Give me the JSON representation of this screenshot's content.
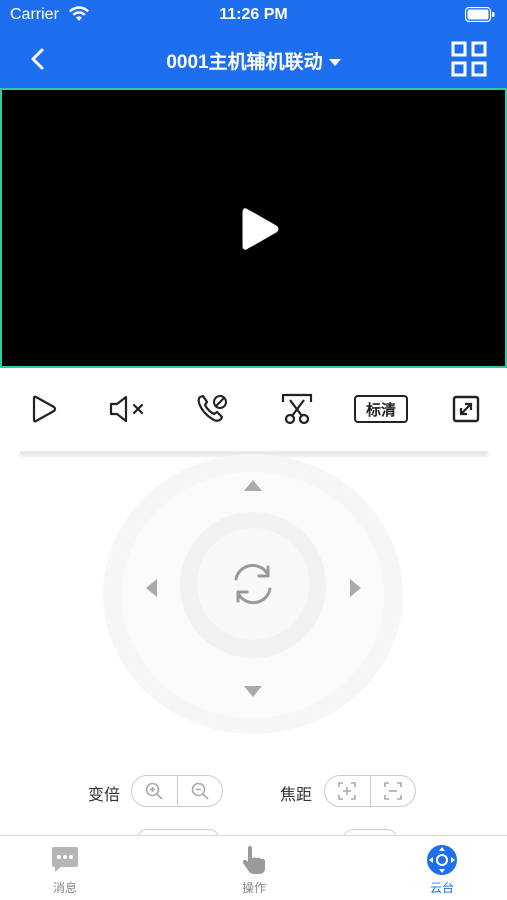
{
  "status_bar": {
    "carrier": "Carrier",
    "time": "11:26 PM"
  },
  "nav": {
    "title": "0001主机辅机联动",
    "back_icon": "chevron-left-icon",
    "grid_icon": "grid-view-icon"
  },
  "video": {
    "play_icon": "play-icon",
    "border_color": "#2ec9a5"
  },
  "toolbar": {
    "play_icon": "play-outline-icon",
    "mute_icon": "speaker-muted-icon",
    "call_icon": "phone-disabled-icon",
    "snapshot_icon": "scissors-icon",
    "quality_label": "标清",
    "fullscreen_icon": "fullscreen-icon"
  },
  "ptz": {
    "center_icon": "refresh-icon"
  },
  "controls": {
    "zoom_label": "变倍",
    "focus_label": "焦距"
  },
  "tabs": [
    {
      "label": "消息",
      "icon": "chat-icon"
    },
    {
      "label": "操作",
      "icon": "hand-pointer-icon"
    },
    {
      "label": "云台",
      "icon": "ptz-icon"
    }
  ],
  "colors": {
    "brand": "#1e6ff0",
    "icon_gray": "#aaaaaa"
  }
}
